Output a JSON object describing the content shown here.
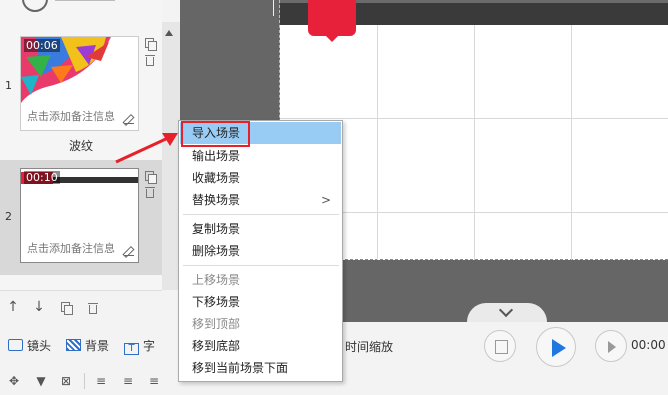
{
  "scenes": [
    {
      "number": "1",
      "time": "00:06",
      "note": "点击添加备注信息",
      "name": "波纹"
    },
    {
      "number": "2",
      "time": "00:10",
      "note": "点击添加备注信息",
      "name": ""
    }
  ],
  "toolbar": {
    "camera_label": "镜头",
    "background_label": "背景",
    "text_label": "字",
    "time_scale_label": "时间缩放",
    "time_readout": "00:00"
  },
  "context_menu": {
    "items": [
      {
        "label": "导入场景",
        "state": "hover"
      },
      {
        "label": "输出场景",
        "state": "normal"
      },
      {
        "label": "收藏场景",
        "state": "normal"
      },
      {
        "label": "替换场景",
        "state": "normal",
        "submenu": true
      },
      {
        "label": "复制场景",
        "state": "normal"
      },
      {
        "label": "删除场景",
        "state": "normal"
      },
      {
        "label": "上移场景",
        "state": "disabled"
      },
      {
        "label": "下移场景",
        "state": "normal"
      },
      {
        "label": "移到顶部",
        "state": "disabled"
      },
      {
        "label": "移到底部",
        "state": "normal"
      },
      {
        "label": "移到当前场景下面",
        "state": "normal"
      }
    ],
    "submenu_indicator": ">"
  },
  "colors": {
    "highlight_red": "#e8202a",
    "hover_blue": "#99ccf5",
    "accent_blue": "#1e78e0",
    "shape_red": "#e8213a"
  },
  "icons": [
    "copy-icon",
    "trash-icon",
    "edit-icon",
    "arrow-up-icon",
    "arrow-down-icon",
    "play-icon",
    "filter-icon",
    "locate-icon"
  ]
}
